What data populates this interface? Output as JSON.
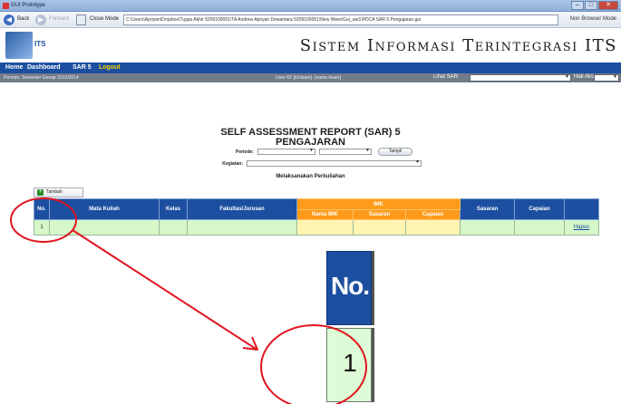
{
  "window": {
    "title": "GUI Prototype",
    "controls": [
      "–",
      "□",
      "✕"
    ]
  },
  "toolbar": {
    "back_label": "Back",
    "forward_label": "Forward",
    "close_mode_label": "Close Mode",
    "url": "C:\\Users\\Apriyan\\Dropbox\\Tugas Akhir 5209100051\\TA Andrew Apriyan Dewantara 5209100051\\New Www\\Gui_sar1\\PDCA SAR 5 Pengajaran.gui",
    "browser_mode": "Non Browser Mode"
  },
  "header": {
    "logo_text": "ITS",
    "site_title": "Sistem Informasi Terintegrasi ITS"
  },
  "menu": {
    "items": [
      "Home",
      "Dashboard",
      "SAR 5",
      "Logout"
    ]
  },
  "status": {
    "period": "Periode: Semester Genap 2013/2014",
    "user": "User ID: [id.itsaer]- [nama itsaer]",
    "lihat_sar_label": "Lihat SAR:",
    "hak_akses_label": "Hak Akses:"
  },
  "report": {
    "title_line1": "SELF ASSESSMENT REPORT (SAR) 5",
    "title_line2": "PENGAJARAN",
    "periode_label": "Periode:",
    "kegiatan_label": "Kegiatan:",
    "tampil_button": "Tampil",
    "subheading": "Melaksanakan Perkuliahan",
    "tambah_button": "Tambah"
  },
  "table": {
    "headers": {
      "no": "No.",
      "mata_kuliah": "Mata Kuliah",
      "kelas": "Kelas",
      "fakultas": "Fakultas/Jurusan",
      "imk": "IMK",
      "nama_imk": "Nama IMK",
      "imk_sasaran": "Sasaran",
      "imk_capaian": "Capaian",
      "sasaran": "Sasaran",
      "capaian": "Capaian"
    },
    "rows": [
      {
        "no": "1",
        "action": "Hapus"
      }
    ]
  },
  "zoom": {
    "header_label": "No.",
    "cell_value": "1"
  },
  "colors": {
    "menu_blue": "#1c4fa0",
    "imk_orange": "#ff9a1a",
    "row_green": "#d6f7c8",
    "annotation_red": "#e0141e"
  }
}
